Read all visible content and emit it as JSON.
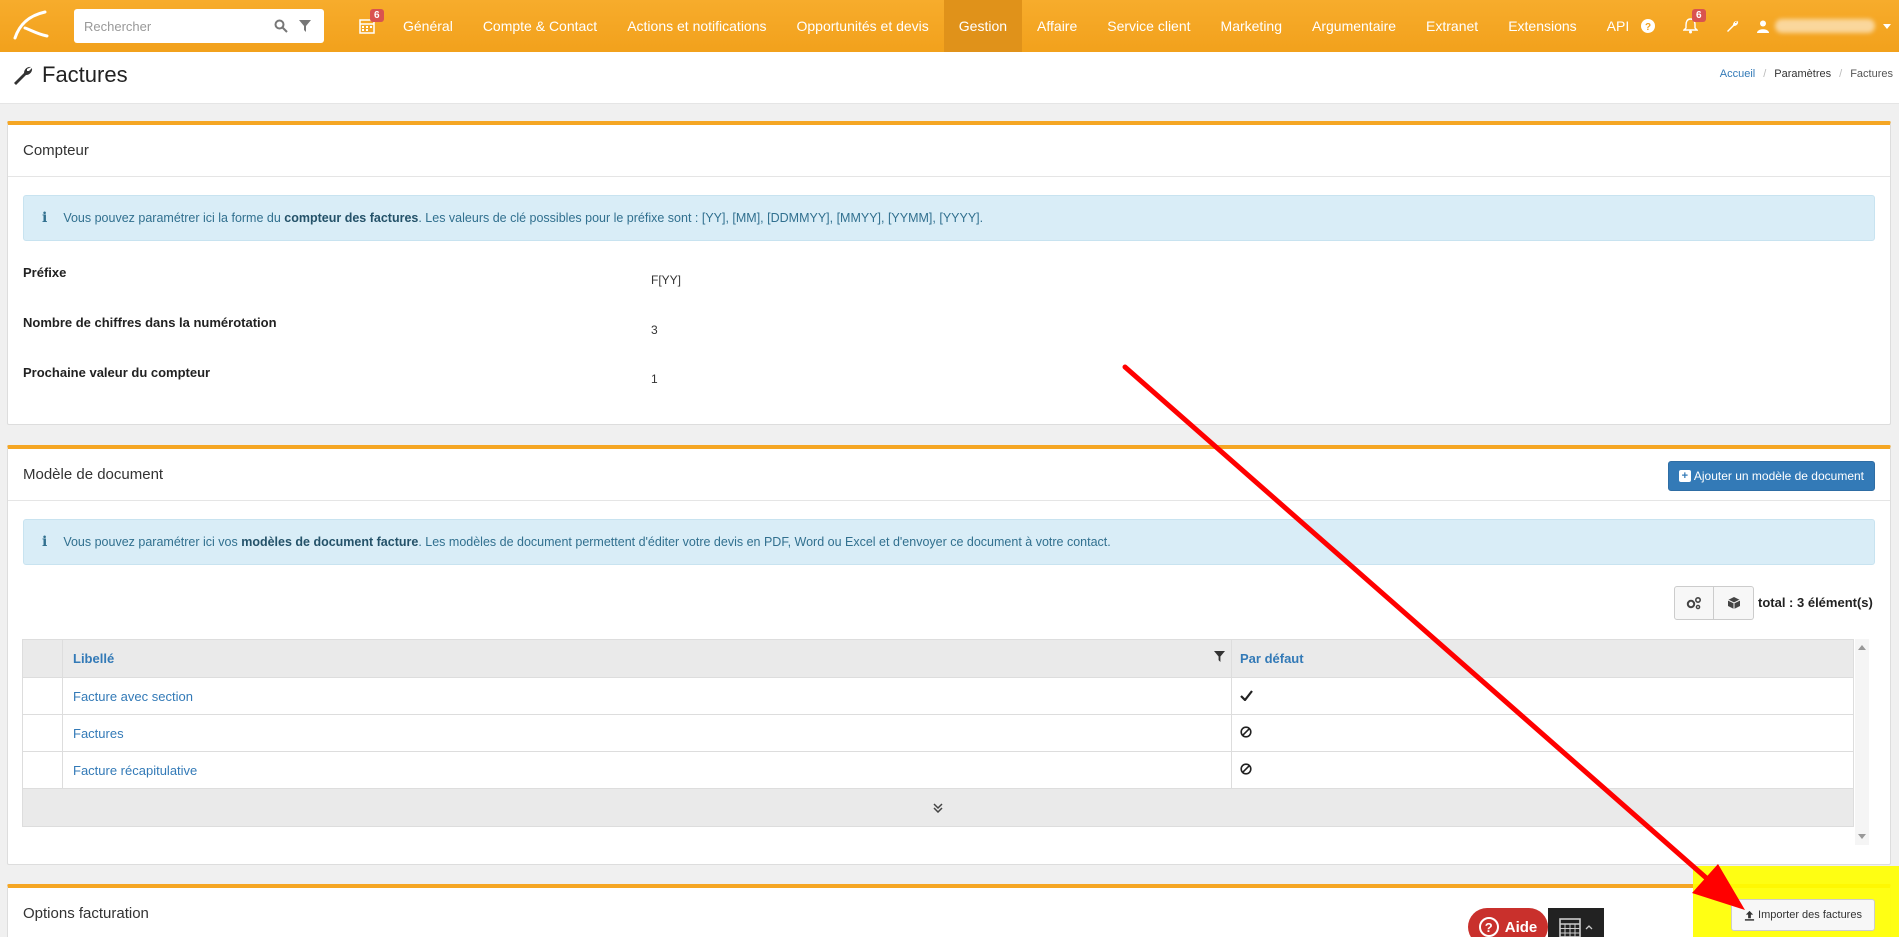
{
  "navbar": {
    "search_placeholder": "Rechercher",
    "calendar_badge": "6",
    "menu": [
      "Général",
      "Compte & Contact",
      "Actions et notifications",
      "Opportunités et devis",
      "Gestion",
      "Affaire",
      "Service client",
      "Marketing",
      "Argumentaire",
      "Extranet",
      "Extensions",
      "API"
    ],
    "active_menu": "Gestion",
    "notifications_badge": "6"
  },
  "page": {
    "title": "Factures",
    "breadcrumb": [
      "Accueil",
      "Paramètres",
      "Factures"
    ]
  },
  "compteur": {
    "heading": "Compteur",
    "info_prefix": "Vous pouvez paramétrer ici la forme du ",
    "info_bold": "compteur des factures",
    "info_suffix": ". Les valeurs de clé possibles pour le préfixe sont : [YY], [MM], [DDMMYY], [MMYY], [YYMM], [YYYY].",
    "fields": [
      {
        "label": "Préfixe",
        "value": "F[YY]"
      },
      {
        "label": "Nombre de chiffres dans la numérotation",
        "value": "3"
      },
      {
        "label": "Prochaine valeur du compteur",
        "value": "1"
      }
    ]
  },
  "modele": {
    "heading": "Modèle de document",
    "add_button": "Ajouter un modèle de document",
    "info_prefix": "Vous pouvez paramétrer ici vos ",
    "info_bold": "modèles de document facture",
    "info_suffix": ". Les modèles de document permettent d'éditer votre devis en PDF, Word ou Excel et d'envoyer ce document à votre contact.",
    "total": "total : 3 élément(s)",
    "columns": [
      "Libellé",
      "Par défaut"
    ],
    "rows": [
      {
        "label": "Facture avec section",
        "default": "check"
      },
      {
        "label": "Factures",
        "default": "ban"
      },
      {
        "label": "Facture récapitulative",
        "default": "ban"
      }
    ]
  },
  "options": {
    "heading": "Options facturation",
    "import_button": "Importer des factures"
  },
  "floating": {
    "help_label": "Aide"
  },
  "colors": {
    "brand_orange": "#f5a623",
    "link_blue": "#337ab7",
    "annotation_red": "#ff0000",
    "highlight_yellow": "#ffff00"
  }
}
